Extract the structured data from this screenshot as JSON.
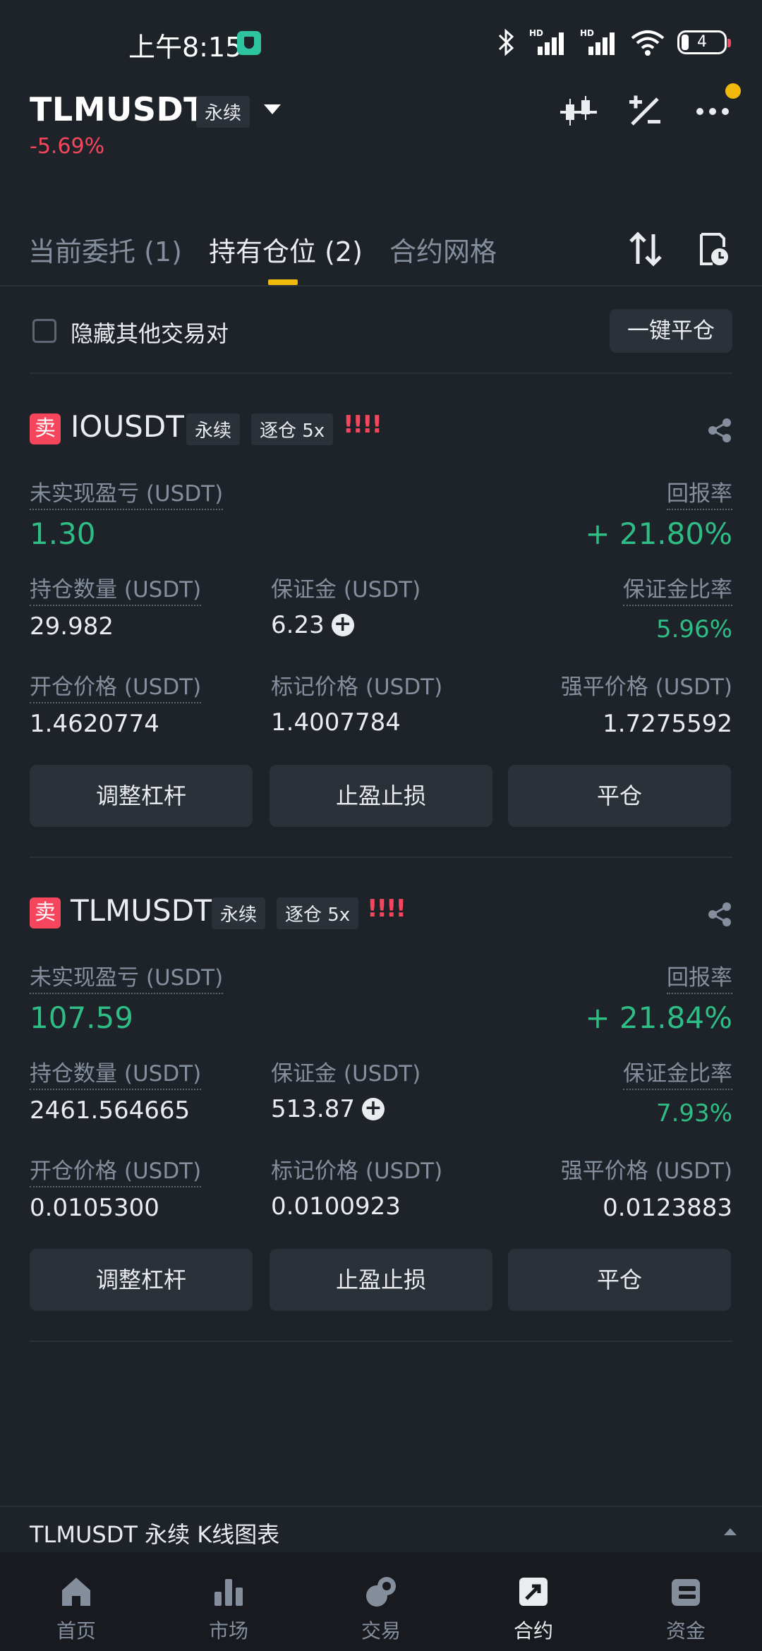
{
  "status_bar": {
    "time": "上午8:15",
    "battery": "4"
  },
  "header": {
    "symbol": "TLMUSDT",
    "contract_type": "永续",
    "change": "-5.69%"
  },
  "tabs": [
    {
      "label": "当前委托 (1)",
      "active": false
    },
    {
      "label": "持有仓位 (2)",
      "active": true
    },
    {
      "label": "合约网格",
      "active": false
    }
  ],
  "filter": {
    "hide_others_label": "隐藏其他交易对",
    "close_all_label": "一键平仓"
  },
  "positions": [
    {
      "side": "卖",
      "symbol": "IOUSDT",
      "contract_type": "永续",
      "margin_mode": "逐仓 5x",
      "warning": "!!!!",
      "unrealized_pnl_label": "未实现盈亏 (USDT)",
      "unrealized_pnl": "1.30",
      "roe_label": "回报率",
      "roe": "+ 21.80%",
      "size_label": "持仓数量 (USDT)",
      "size": "29.982",
      "margin_label": "保证金 (USDT)",
      "margin": "6.23",
      "margin_ratio_label": "保证金比率",
      "margin_ratio": "5.96%",
      "entry_price_label": "开仓价格 (USDT)",
      "entry_price": "1.4620774",
      "mark_price_label": "标记价格 (USDT)",
      "mark_price": "1.4007784",
      "liq_price_label": "强平价格 (USDT)",
      "liq_price": "1.7275592",
      "actions": [
        "调整杠杆",
        "止盈止损",
        "平仓"
      ]
    },
    {
      "side": "卖",
      "symbol": "TLMUSDT",
      "contract_type": "永续",
      "margin_mode": "逐仓 5x",
      "warning": "!!!!",
      "unrealized_pnl_label": "未实现盈亏 (USDT)",
      "unrealized_pnl": "107.59",
      "roe_label": "回报率",
      "roe": "+ 21.84%",
      "size_label": "持仓数量 (USDT)",
      "size": "2461.564665",
      "margin_label": "保证金 (USDT)",
      "margin": "513.87",
      "margin_ratio_label": "保证金比率",
      "margin_ratio": "7.93%",
      "entry_price_label": "开仓价格 (USDT)",
      "entry_price": "0.0105300",
      "mark_price_label": "标记价格 (USDT)",
      "mark_price": "0.0100923",
      "liq_price_label": "强平价格 (USDT)",
      "liq_price": "0.0123883",
      "actions": [
        "调整杠杆",
        "止盈止损",
        "平仓"
      ]
    }
  ],
  "chart_bar": {
    "label": "TLMUSDT 永续  K线图表"
  },
  "bottom_nav": [
    {
      "label": "首页",
      "icon": "home-icon",
      "active": false
    },
    {
      "label": "市场",
      "icon": "market-chart-icon",
      "active": false
    },
    {
      "label": "交易",
      "icon": "trade-icon",
      "active": false
    },
    {
      "label": "合约",
      "icon": "futures-icon",
      "active": true
    },
    {
      "label": "资金",
      "icon": "wallet-icon",
      "active": false
    }
  ],
  "colors": {
    "background": "#1e2329",
    "accent": "#f0b90b",
    "positive": "#2ebd85",
    "negative": "#f6465d",
    "muted": "#848e9c"
  }
}
